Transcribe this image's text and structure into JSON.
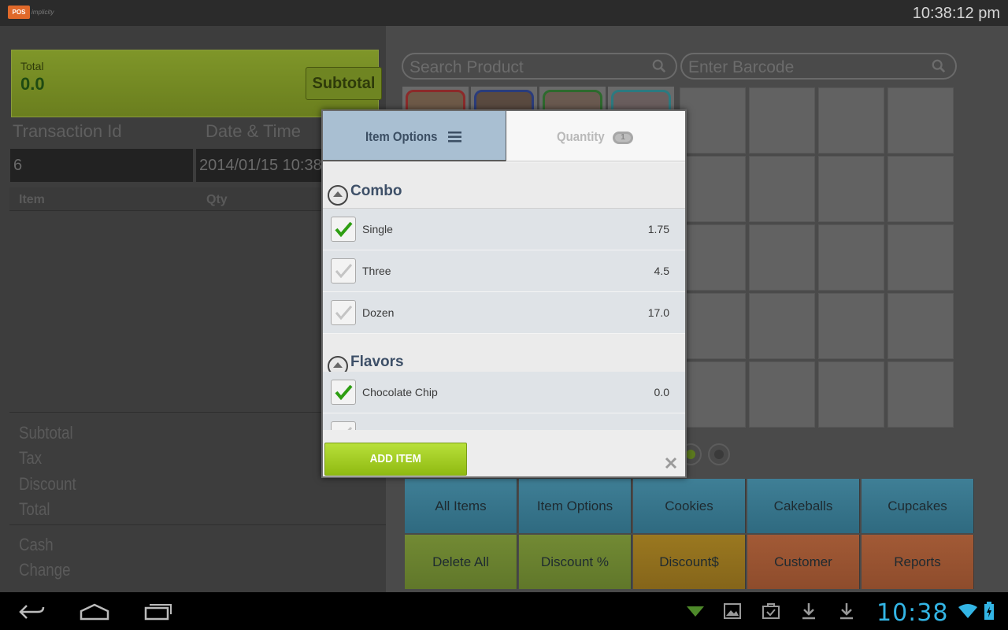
{
  "status_bar": {
    "logo_badge": "POS",
    "logo_text": "implicity",
    "time": "10:38:12 pm"
  },
  "left": {
    "total_label": "Total",
    "total_value": "0.0",
    "subtotal_button": "Subtotal",
    "transaction_id_label": "Transaction Id",
    "date_time_label": "Date & Time",
    "transaction_id_value": "6",
    "date_time_value": "2014/01/15 10:38",
    "table_headers": [
      "Item",
      "Qty"
    ],
    "summary": [
      "Subtotal",
      "Tax",
      "Discount",
      "Total"
    ],
    "payment": [
      "Cash",
      "Change"
    ]
  },
  "search": {
    "product_placeholder": "Search Product",
    "barcode_placeholder": "Enter Barcode"
  },
  "categories": [
    {
      "label": "All Items",
      "color": "#3f7f96"
    },
    {
      "label": "Item Options",
      "color": "#3f7f96"
    },
    {
      "label": "Cookies",
      "color": "#3f7f96"
    },
    {
      "label": "Cakeballs",
      "color": "#3f7f96"
    },
    {
      "label": "Cupcakes",
      "color": "#3f7f96"
    },
    {
      "label": "Delete All",
      "color": "#728a34"
    },
    {
      "label": "Discount %",
      "color": "#728a34"
    },
    {
      "label": "Discount$",
      "color": "#9a7820"
    },
    {
      "label": "Customer",
      "color": "#a25a36"
    },
    {
      "label": "Reports",
      "color": "#a25a36"
    }
  ],
  "dialog": {
    "tab_item_options": "Item Options",
    "tab_quantity": "Quantity",
    "quantity_value": "1",
    "sections": [
      {
        "title": "Combo",
        "items": [
          {
            "label": "Single",
            "value": "1.75",
            "checked": true
          },
          {
            "label": "Three",
            "value": "4.5",
            "checked": false
          },
          {
            "label": "Dozen",
            "value": "17.0",
            "checked": false
          }
        ]
      },
      {
        "title": "Flavors",
        "items": [
          {
            "label": "Chocolate Chip",
            "value": "0.0",
            "checked": true
          }
        ]
      }
    ],
    "add_item_button": "ADD ITEM"
  },
  "nav": {
    "clock": "10:38"
  },
  "colors": {
    "accent": "#8fba12",
    "nav_clock": "#33b5e5",
    "tab_active": "#a9bfd2"
  }
}
